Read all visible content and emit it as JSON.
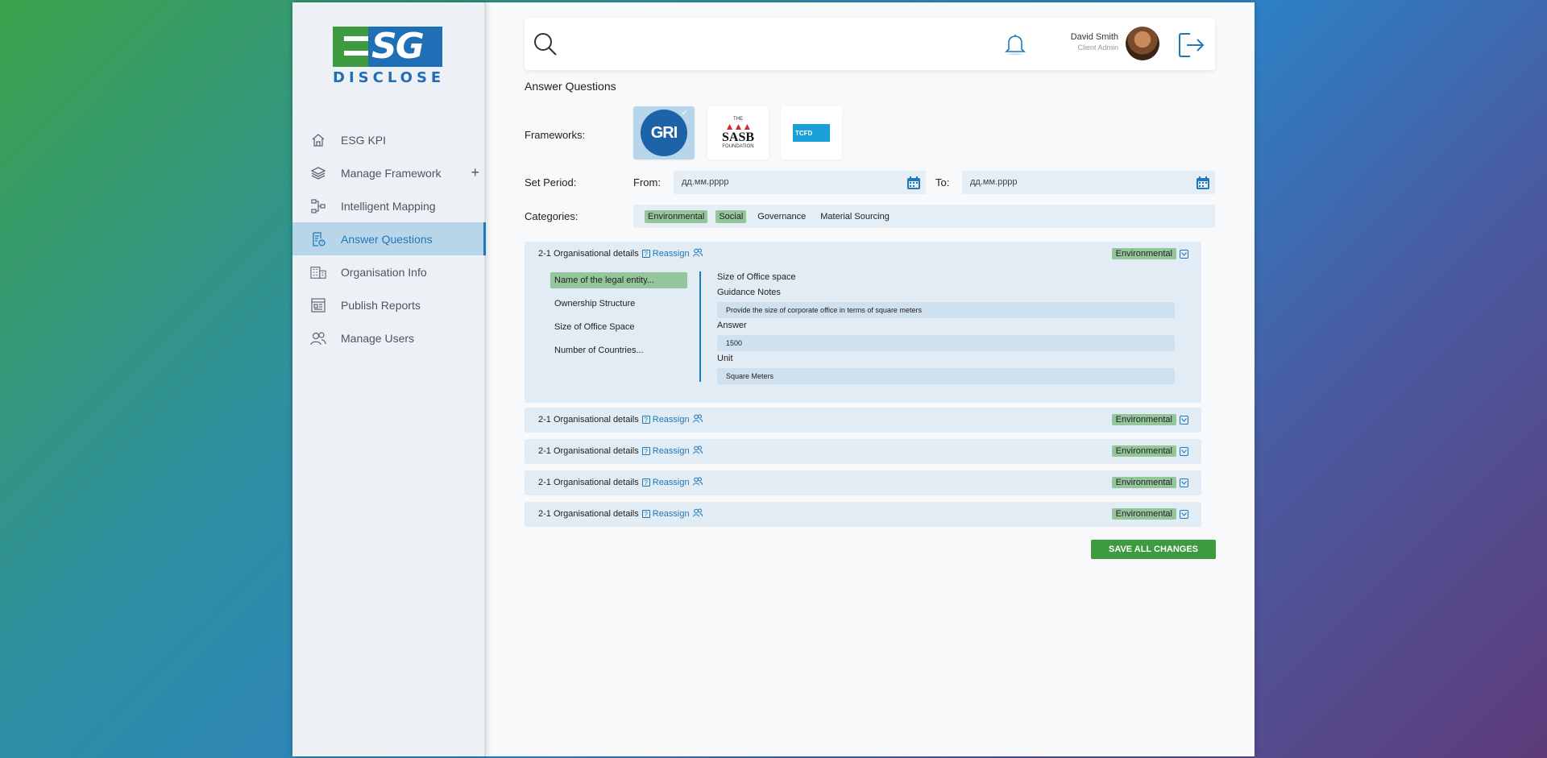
{
  "brand": {
    "logo_top": "SG",
    "logo_bottom": "DISCLOSE"
  },
  "sidebar": {
    "items": [
      {
        "label": "ESG KPI",
        "icon": "home-icon"
      },
      {
        "label": "Manage Framework",
        "icon": "layers-icon",
        "extra": "+"
      },
      {
        "label": "Intelligent Mapping",
        "icon": "mapping-icon"
      },
      {
        "label": "Answer Questions",
        "icon": "question-doc-icon",
        "active": true
      },
      {
        "label": "Organisation Info",
        "icon": "building-icon"
      },
      {
        "label": "Publish Reports",
        "icon": "report-icon"
      },
      {
        "label": "Manage Users",
        "icon": "users-icon"
      }
    ]
  },
  "topbar": {
    "user_name": "David Smith",
    "user_role": "Client Admin"
  },
  "page": {
    "title": "Answer Questions",
    "frameworks_label": "Frameworks:",
    "frameworks": [
      {
        "name": "GRI",
        "selected": true,
        "check": "✓"
      },
      {
        "name": "SASB",
        "line1": "THE",
        "line2": "SASB",
        "line3": "FOUNDATION",
        "selected": false
      },
      {
        "name": "TCFD",
        "selected": false
      }
    ],
    "period_label": "Set Period:",
    "from_label": "From:",
    "to_label": "To:",
    "from_value": "дд.мм.рррр",
    "to_value": "дд.мм.рррр",
    "categories_label": "Categories:",
    "categories": [
      {
        "label": "Environmental",
        "on": true
      },
      {
        "label": "Social",
        "on": true
      },
      {
        "label": "Governance",
        "on": false
      },
      {
        "label": "Material Sourcing",
        "on": false
      }
    ]
  },
  "accordion": {
    "title": "2-1 Organisational details",
    "q_mark": "?",
    "reassign": "Reassign",
    "badge": "Environmental",
    "sub_items": [
      "Name of the legal entity...",
      "Ownership Structure",
      "Size of Office Space",
      "Number of Countries..."
    ],
    "detail": {
      "heading": "Size of Office space",
      "guidance_label": "Guidance Notes",
      "guidance_value": "Provide the size of corporate office in terms of square meters",
      "answer_label": "Answer",
      "answer_value": "1500",
      "unit_label": "Unit",
      "unit_value": "Square Meters"
    }
  },
  "save_label": "SAVE ALL CHANGES",
  "colors": {
    "accent": "#1f78b8",
    "green": "#3d9a3f",
    "badge": "#95c59b"
  }
}
